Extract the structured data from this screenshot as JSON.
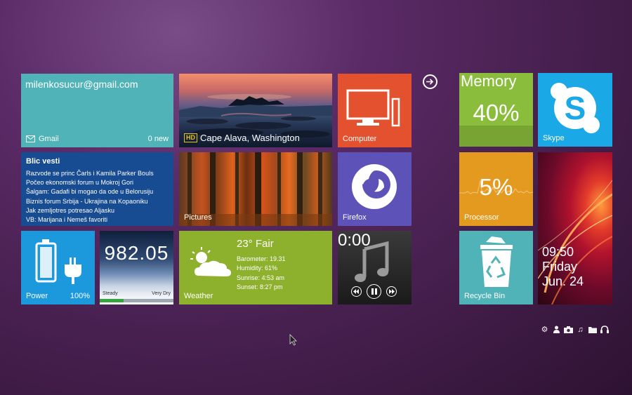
{
  "gmail": {
    "email": "milenkosucur@gmail.com",
    "label": "Gmail",
    "count": "0 new"
  },
  "photo": {
    "caption": "Cape Alava, Washington",
    "badge": "HD"
  },
  "computer": {
    "label": "Computer"
  },
  "blic": {
    "title": "Blic vesti",
    "items": [
      "Razvode se princ Čarls i Kamila Parker Bouls",
      "Počeo ekonomski forum u Mokroj Gori",
      "Šalgam: Gadafi bi mogao da ode u Belorusiju",
      "Biznis forum Srbija - Ukrajina na Kopaoniku",
      "Jak zemljotres potresao Aljasku",
      "VB: Marijana i Nemeš favoriti"
    ]
  },
  "pictures": {
    "label": "Pictures"
  },
  "firefox": {
    "label": "Firefox"
  },
  "power": {
    "label": "Power",
    "value": "100%"
  },
  "barometer": {
    "value": "982.05",
    "left": "Steady",
    "right": "Very Dry",
    "level": 0.32
  },
  "weather": {
    "label": "Weather",
    "temp": "23° Fair",
    "details": [
      "Barometer: 19.31",
      "Humidity: 61%",
      "Sunrise: 4:53 am",
      "Sunset: 8:27 pm"
    ]
  },
  "music": {
    "time": "0:00"
  },
  "memory": {
    "label": "Memory",
    "value": "40%"
  },
  "skype": {
    "label": "Skype"
  },
  "processor": {
    "label": "Processor",
    "value": "5%"
  },
  "clock": {
    "time": "09:50",
    "day": "Friday",
    "date": "Jun. 24"
  },
  "recycle": {
    "label": "Recycle Bin"
  },
  "colors": {
    "gmail": "#4fb3b8",
    "computer": "#e4512f",
    "blic": "#174b92",
    "firefox": "#5c52b8",
    "power": "#1c99dd",
    "weather": "#8db12d",
    "memory": "#8bbd3c",
    "skype": "#1ba8e6",
    "processor": "#e39a1e",
    "recycle": "#4fb3b8"
  },
  "icons": [
    "gear-icon",
    "user-icon",
    "camera-icon",
    "music-note-icon",
    "folder-icon",
    "headphones-icon"
  ]
}
